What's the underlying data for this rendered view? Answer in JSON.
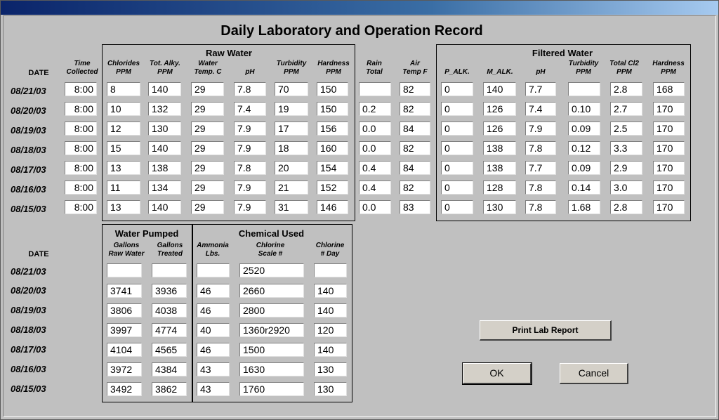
{
  "form_title": "Daily Laboratory and Operation Record",
  "raw_water": {
    "group_label": "Raw Water",
    "date_header": "DATE",
    "headers": [
      [
        "Time",
        "Collected"
      ],
      [
        "Chlorides",
        "PPM"
      ],
      [
        "Tot. Alky.",
        "PPM"
      ],
      [
        "Water",
        "Temp. C"
      ],
      [
        "",
        "pH"
      ],
      [
        "Turbidity",
        "PPM"
      ],
      [
        "Hardness",
        "PPM"
      ],
      [
        "Rain",
        "Total"
      ],
      [
        "Air",
        "Temp F"
      ]
    ]
  },
  "filtered_water": {
    "group_label": "Filtered Water",
    "headers": [
      [
        "",
        "P_ALK."
      ],
      [
        "",
        "M_ALK."
      ],
      [
        "",
        "pH"
      ],
      [
        "Turbidity",
        "PPM"
      ],
      [
        "Total Cl2",
        "PPM"
      ],
      [
        "Hardness",
        "PPM"
      ]
    ]
  },
  "upper_rows": [
    {
      "date": "08/21/03",
      "v": [
        "8:00",
        "8",
        "140",
        "29",
        "7.8",
        "70",
        "150",
        "",
        "82",
        "0",
        "140",
        "7.7",
        "",
        "2.8",
        "168"
      ]
    },
    {
      "date": "08/20/03",
      "v": [
        "8:00",
        "10",
        "132",
        "29",
        "7.4",
        "19",
        "150",
        "0.2",
        "82",
        "0",
        "126",
        "7.4",
        "0.10",
        "2.7",
        "170"
      ]
    },
    {
      "date": "08/19/03",
      "v": [
        "8:00",
        "12",
        "130",
        "29",
        "7.9",
        "17",
        "156",
        "0.0",
        "84",
        "0",
        "126",
        "7.9",
        "0.09",
        "2.5",
        "170"
      ]
    },
    {
      "date": "08/18/03",
      "v": [
        "8:00",
        "15",
        "140",
        "29",
        "7.9",
        "18",
        "160",
        "0.0",
        "82",
        "0",
        "138",
        "7.8",
        "0.12",
        "3.3",
        "170"
      ]
    },
    {
      "date": "08/17/03",
      "v": [
        "8:00",
        "13",
        "138",
        "29",
        "7.8",
        "20",
        "154",
        "0.4",
        "84",
        "0",
        "138",
        "7.7",
        "0.09",
        "2.9",
        "170"
      ]
    },
    {
      "date": "08/16/03",
      "v": [
        "8:00",
        "11",
        "134",
        "29",
        "7.9",
        "21",
        "152",
        "0.4",
        "82",
        "0",
        "128",
        "7.8",
        "0.14",
        "3.0",
        "170"
      ]
    },
    {
      "date": "08/15/03",
      "v": [
        "8:00",
        "13",
        "140",
        "29",
        "7.9",
        "31",
        "146",
        "0.0",
        "83",
        "0",
        "130",
        "7.8",
        "1.68",
        "2.8",
        "170"
      ]
    }
  ],
  "water_pumped": {
    "group_label": "Water Pumped",
    "date_header": "DATE",
    "headers": [
      [
        "Gallons",
        "Raw Water"
      ],
      [
        "Gallons",
        "Treated"
      ]
    ]
  },
  "chemical_used": {
    "group_label": "Chemical Used",
    "headers": [
      [
        "Ammonia",
        "Lbs."
      ],
      [
        "Chlorine",
        "Scale #"
      ],
      [
        "Chlorine",
        "# Day"
      ]
    ]
  },
  "lower_rows": [
    {
      "date": "08/21/03",
      "v": [
        "",
        "",
        "",
        "2520",
        ""
      ]
    },
    {
      "date": "08/20/03",
      "v": [
        "3741",
        "3936",
        "46",
        "2660",
        "140"
      ]
    },
    {
      "date": "08/19/03",
      "v": [
        "3806",
        "4038",
        "46",
        "2800",
        "140"
      ]
    },
    {
      "date": "08/18/03",
      "v": [
        "3997",
        "4774",
        "40",
        "1360r2920",
        "120"
      ]
    },
    {
      "date": "08/17/03",
      "v": [
        "4104",
        "4565",
        "46",
        "1500",
        "140"
      ]
    },
    {
      "date": "08/16/03",
      "v": [
        "3972",
        "4384",
        "43",
        "1630",
        "130"
      ]
    },
    {
      "date": "08/15/03",
      "v": [
        "3492",
        "3862",
        "43",
        "1760",
        "130"
      ]
    }
  ],
  "buttons": {
    "print_lab_report": "Print Lab Report",
    "ok": "OK",
    "cancel": "Cancel"
  }
}
